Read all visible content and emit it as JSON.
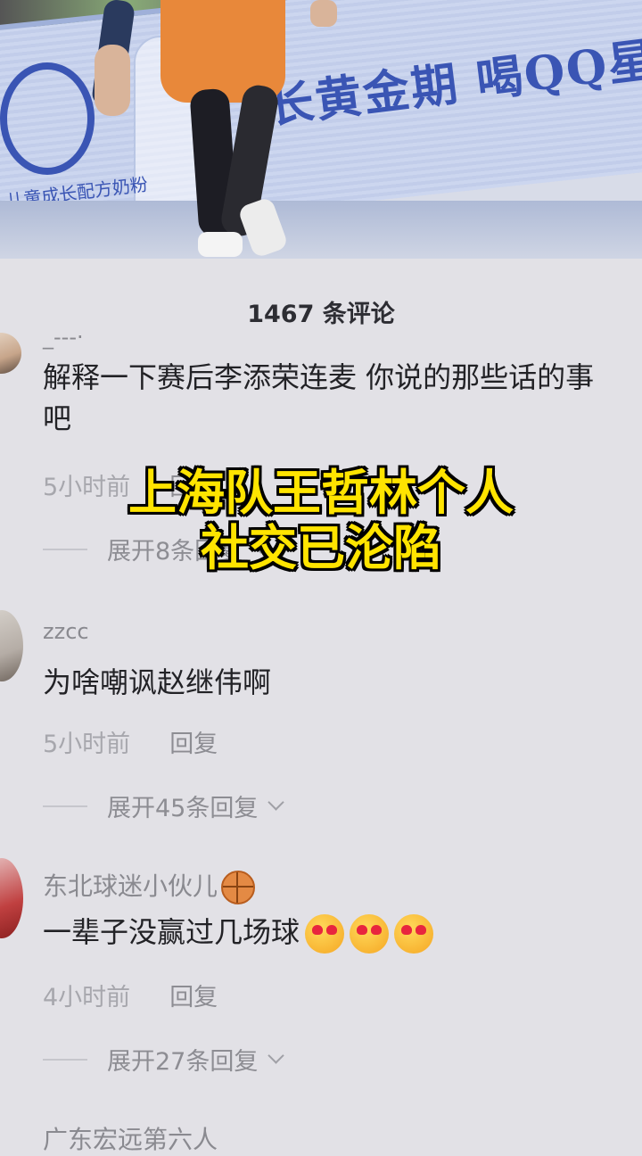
{
  "video": {
    "ad_text": "长黄金期 喝QQ星榛高奶",
    "ad_sub": "儿童成长配方奶粉"
  },
  "comments_header": {
    "count_label": "1467 条评论"
  },
  "comments": [
    {
      "username": "_---·",
      "text": "解释一下赛后李添荣连麦 你说的那些话的事吧",
      "time": "5小时前",
      "reply_label": "回复",
      "expand_label": "展开8条回复"
    },
    {
      "username": "zzcc",
      "text": "为啥嘲讽赵继伟啊",
      "time": "5小时前",
      "reply_label": "回复",
      "expand_label": "展开45条回复"
    },
    {
      "username": "东北球迷小伙儿",
      "username_icon": "basketball-emoji",
      "text": "一辈子没赢过几场球",
      "text_icons": [
        "heart-eyes-emoji",
        "heart-eyes-emoji",
        "heart-eyes-emoji"
      ],
      "time": "4小时前",
      "reply_label": "回复",
      "expand_label": "展开27条回复"
    },
    {
      "username": "广东宏远第六人"
    }
  ],
  "overlay_caption": {
    "line1": "上海队王哲林个人",
    "line2": "社交已沦陷"
  },
  "colors": {
    "caption": "#ffe400",
    "sheet_bg": "#e2e1e6",
    "text": "#222226",
    "muted": "#a7a7ad"
  }
}
